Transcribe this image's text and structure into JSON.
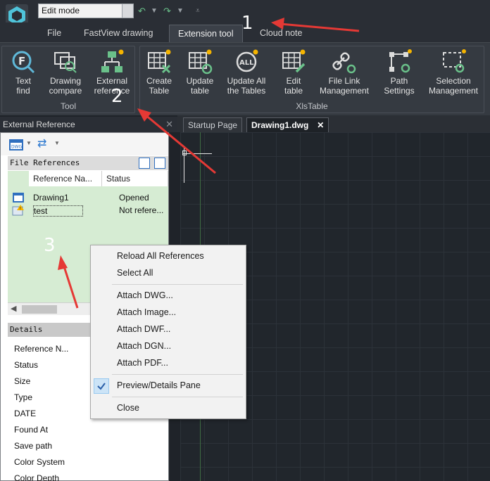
{
  "titlebar": {
    "mode_value": "Edit mode",
    "undo_icon": "undo-icon",
    "redo_icon": "redo-icon"
  },
  "menu_tabs": [
    "File",
    "FastView drawing",
    "Extension tool",
    "Cloud note"
  ],
  "active_tab": "Extension tool",
  "ribbon": {
    "tool_group_title": "Tool",
    "tool_buttons": [
      {
        "label": "Text\nfind",
        "icon": "text-find-icon"
      },
      {
        "label": "Drawing\ncompare",
        "icon": "drawing-compare-icon"
      },
      {
        "label": "External\nreference",
        "icon": "external-reference-icon"
      }
    ],
    "xls_group_title": "XlsTable",
    "xls_buttons": [
      {
        "label": "Create\nTable",
        "icon": "create-table-icon"
      },
      {
        "label": "Update\ntable",
        "icon": "update-table-icon"
      },
      {
        "label": "Update All\nthe Tables",
        "icon": "update-all-tables-icon"
      },
      {
        "label": "Edit\ntable",
        "icon": "edit-table-icon"
      },
      {
        "label": "File Link\nManagement",
        "icon": "file-link-icon"
      },
      {
        "label": "Path\nSettings",
        "icon": "path-settings-icon"
      },
      {
        "label": "Selection\nManagement",
        "icon": "selection-management-icon"
      }
    ]
  },
  "xref_panel": {
    "title": "External Reference",
    "file_references_header": "File References",
    "columns": [
      "Reference Na...",
      "Status"
    ],
    "rows": [
      {
        "name": "Drawing1",
        "status": "Opened",
        "icon": "dwg-file-icon"
      },
      {
        "name": "test",
        "status": "Not refere...",
        "icon": "image-warning-icon"
      }
    ],
    "details_header": "Details",
    "details_rows": [
      "Reference N...",
      "Status",
      "Size",
      "Type",
      "DATE",
      "Found At",
      "Save path",
      "Color System",
      "Color Depth"
    ]
  },
  "doc_tabs": [
    "Startup Page",
    "Drawing1.dwg"
  ],
  "context_menu": {
    "items": [
      "Reload All References",
      "Select All",
      "Attach DWG...",
      "Attach Image...",
      "Attach DWF...",
      "Attach DGN...",
      "Attach PDF...",
      "Preview/Details Pane",
      "Close"
    ],
    "checked_item": "Preview/Details Pane"
  },
  "annotations": [
    "1",
    "2",
    "3"
  ],
  "colors": {
    "arrow": "#e53935",
    "panel_green": "#d6ecd3",
    "ribbon_bg": "#353a41"
  }
}
